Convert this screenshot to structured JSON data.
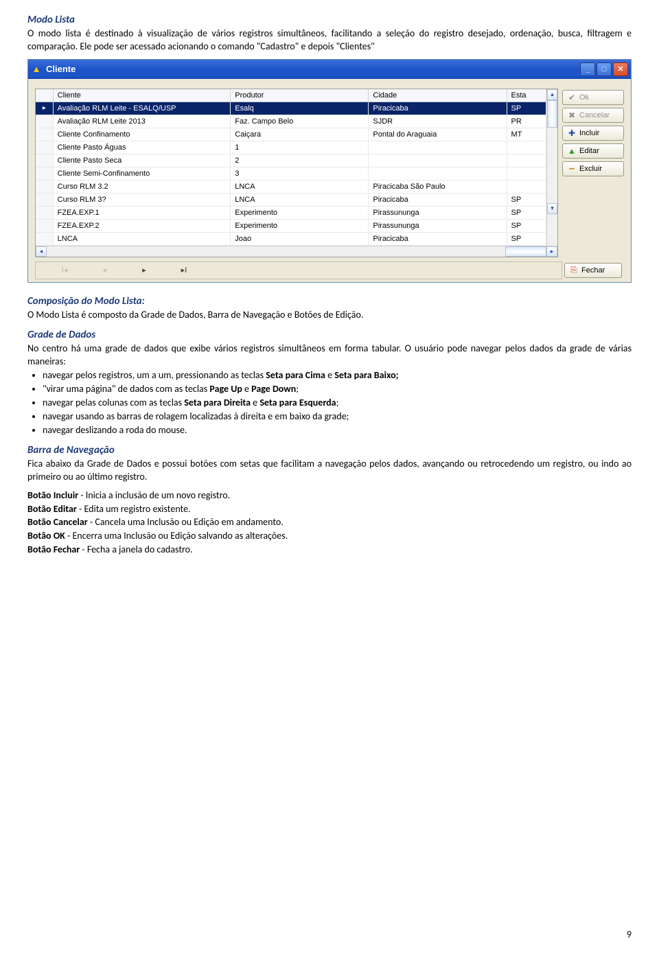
{
  "page_number": "9",
  "h1": "Modo Lista",
  "p1": "O modo lista é destinado à visualização de vários registros simultâneos, facilitando a seleção do registro desejado, ordenação, busca, filtragem e comparação. Ele pode ser acessado acionando o comando \"Cadastro\" e depois \"Clientes\"",
  "window": {
    "title": "Cliente",
    "headers": {
      "col1": "Cliente",
      "col2": "Produtor",
      "col3": "Cidade",
      "col4": "Esta"
    },
    "rows": [
      {
        "cliente": "Avaliação RLM Leite - ESALQ/USP",
        "produtor": "Esalq",
        "cidade": "Piracicaba",
        "esta": "SP",
        "selected": true
      },
      {
        "cliente": "Avaliação RLM Leite 2013",
        "produtor": "Faz. Campo Belo",
        "cidade": "SJDR",
        "esta": "PR"
      },
      {
        "cliente": "Cliente Confinamento",
        "produtor": "Caiçara",
        "cidade": "Pontal do Araguaia",
        "esta": "MT"
      },
      {
        "cliente": "Cliente Pasto Águas",
        "produtor": "1",
        "cidade": "",
        "esta": ""
      },
      {
        "cliente": "Cliente Pasto Seca",
        "produtor": "2",
        "cidade": "",
        "esta": ""
      },
      {
        "cliente": "Cliente Semi-Confinamento",
        "produtor": "3",
        "cidade": "",
        "esta": ""
      },
      {
        "cliente": "Curso RLM 3.2",
        "produtor": "LNCA",
        "cidade": "Piracicaba São Paulo",
        "esta": ""
      },
      {
        "cliente": "Curso RLM 3?",
        "produtor": "LNCA",
        "cidade": "Piracicaba",
        "esta": "SP"
      },
      {
        "cliente": "FZEA.EXP.1",
        "produtor": "Experimento",
        "cidade": "Pirassununga",
        "esta": "SP"
      },
      {
        "cliente": "FZEA.EXP.2",
        "produtor": "Experimento",
        "cidade": "Pirassununga",
        "esta": "SP"
      },
      {
        "cliente": "LNCA",
        "produtor": "Joao",
        "cidade": "Piracicaba",
        "esta": "SP"
      }
    ],
    "buttons": {
      "ok": "Ok",
      "cancelar": "Cancelar",
      "incluir": "Incluir",
      "editar": "Editar",
      "excluir": "Excluir",
      "fechar": "Fechar"
    }
  },
  "h2": "Composição do Modo Lista:",
  "p2": "O Modo Lista é composto da Grade de Dados, Barra de Navegação e Botões de Edição.",
  "h3": "Grade de Dados",
  "p3": "No centro há uma grade de dados que exibe vários registros simultâneos em forma tabular. O usuário pode navegar pelos dados da grade de várias maneiras:",
  "bullets": {
    "b1a": "navegar pelos registros, um a um, pressionando as teclas ",
    "b1b": "Seta para Cima",
    "b1c": " e ",
    "b1d": "Seta para Baixo;",
    "b2a": "\"virar uma página\" de dados com as teclas ",
    "b2b": "Page Up",
    "b2c": " e ",
    "b2d": "Page Down",
    "b2e": ";",
    "b3a": "navegar pelas colunas com as teclas ",
    "b3b": "Seta para Direita",
    "b3c": " e ",
    "b3d": "Seta para Esquerda",
    "b3e": ";",
    "b4": "navegar usando as barras de rolagem localizadas à direita e em baixo da grade;",
    "b5": "navegar deslizando a roda do mouse."
  },
  "h4": "Barra de Navegação",
  "p4": "Fica abaixo da Grade de Dados e possui botões com setas que facilitam a navegação pelos dados, avançando ou retrocedendo um registro, ou indo ao primeiro ou ao último registro.",
  "btn_desc": {
    "l1a": "Botão Incluir",
    "l1b": " - Inicia a inclusão de um novo registro.",
    "l2a": "Botão Editar",
    "l2b": " - Edita um registro existente.",
    "l3a": "Botão Cancelar",
    "l3b": " - Cancela uma Inclusão ou Edição em andamento.",
    "l4a": "Botão OK",
    "l4b": " - Encerra uma Inclusão ou Edição salvando as alterações.",
    "l5a": "Botão Fechar",
    "l5b": " - Fecha a janela do cadastro."
  }
}
